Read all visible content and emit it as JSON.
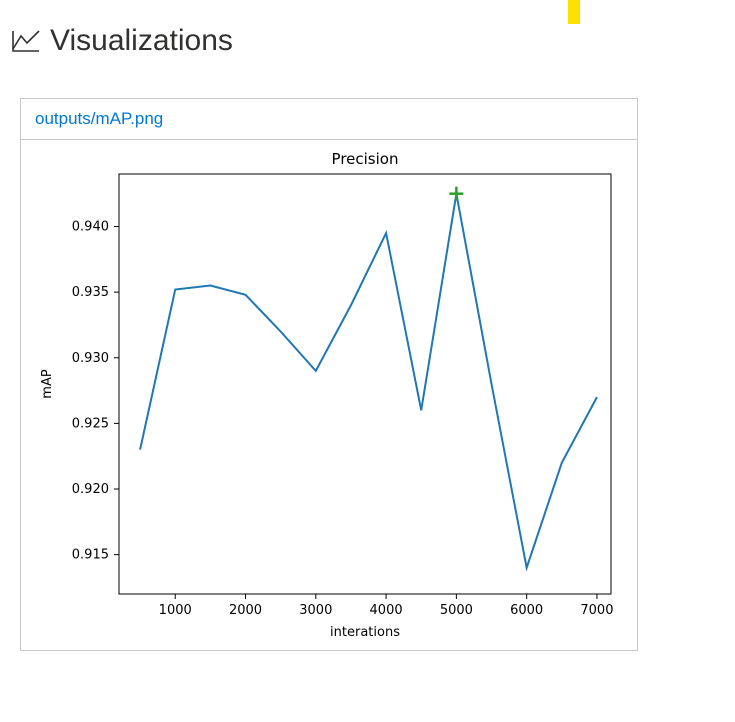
{
  "header": {
    "title": "Visualizations"
  },
  "panel": {
    "link_text": "outputs/mAP.png"
  },
  "chart_data": {
    "type": "line",
    "title": "Precision",
    "xlabel": "interations",
    "ylabel": "mAP",
    "x": [
      500,
      1000,
      1500,
      2000,
      2500,
      3000,
      3500,
      4000,
      4500,
      5000,
      5500,
      6000,
      6500,
      7000
    ],
    "y": [
      0.923,
      0.9352,
      0.9355,
      0.9348,
      0.932,
      0.929,
      0.934,
      0.9395,
      0.926,
      0.9425,
      0.928,
      0.914,
      0.922,
      0.927
    ],
    "xlim": [
      200,
      7200
    ],
    "ylim": [
      0.912,
      0.944
    ],
    "xticks": [
      1000,
      2000,
      3000,
      4000,
      5000,
      6000,
      7000
    ],
    "yticks": [
      0.915,
      0.92,
      0.925,
      0.93,
      0.935,
      0.94
    ],
    "ytick_labels": [
      "0.915",
      "0.920",
      "0.925",
      "0.930",
      "0.935",
      "0.940"
    ],
    "marker": {
      "x": 5000,
      "y": 0.9425
    },
    "line_color": "#1f77b4",
    "marker_color": "#2ca02c"
  }
}
